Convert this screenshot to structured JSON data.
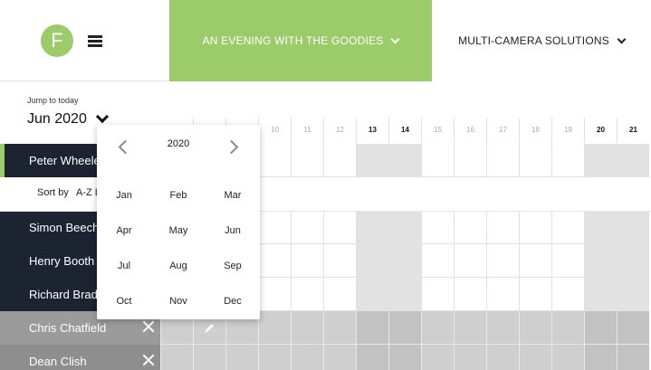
{
  "header": {
    "logo_letter": "F",
    "tabs": [
      {
        "label": "AN EVENING WITH THE GOODIES"
      },
      {
        "label": "MULTI-CAMERA SOLUTIONS"
      }
    ]
  },
  "jump": {
    "label": "Jump to today",
    "current_month": "Jun 2020"
  },
  "days": [
    {
      "n": "10",
      "bold": false
    },
    {
      "n": "11",
      "bold": false
    },
    {
      "n": "12",
      "bold": false
    },
    {
      "n": "13",
      "bold": true
    },
    {
      "n": "14",
      "bold": true
    },
    {
      "n": "15",
      "bold": false
    },
    {
      "n": "16",
      "bold": false
    },
    {
      "n": "17",
      "bold": false
    },
    {
      "n": "18",
      "bold": false
    },
    {
      "n": "19",
      "bold": false
    },
    {
      "n": "20",
      "bold": true
    },
    {
      "n": "21",
      "bold": true
    }
  ],
  "rows": [
    {
      "name": "Peter Wheele",
      "style": "active"
    },
    {
      "name": "Simon Beech",
      "style": "navy"
    },
    {
      "name": "Henry Booth",
      "style": "navy"
    },
    {
      "name": "Richard Brad",
      "style": "navy"
    },
    {
      "name": "Chris Chatfield",
      "style": "grey1"
    },
    {
      "name": "Dean Clish",
      "style": "grey2"
    }
  ],
  "sort": {
    "label": "Sort by",
    "value": "A-Z L"
  },
  "picker": {
    "year": "2020",
    "months": [
      "Jan",
      "Feb",
      "Mar",
      "Apr",
      "May",
      "Jun",
      "Jul",
      "Aug",
      "Sep",
      "Oct",
      "Nov",
      "Dec"
    ]
  },
  "colors": {
    "accent": "#9ccb6a",
    "navy": "#1c2331"
  },
  "icons": {
    "logo": "f-logo-icon",
    "menu": "hamburger-menu-icon",
    "dropdown": "chevron-down-icon",
    "prev": "chevron-left-icon",
    "next": "chevron-right-icon",
    "remove": "close-icon",
    "edit": "pencil-icon"
  }
}
